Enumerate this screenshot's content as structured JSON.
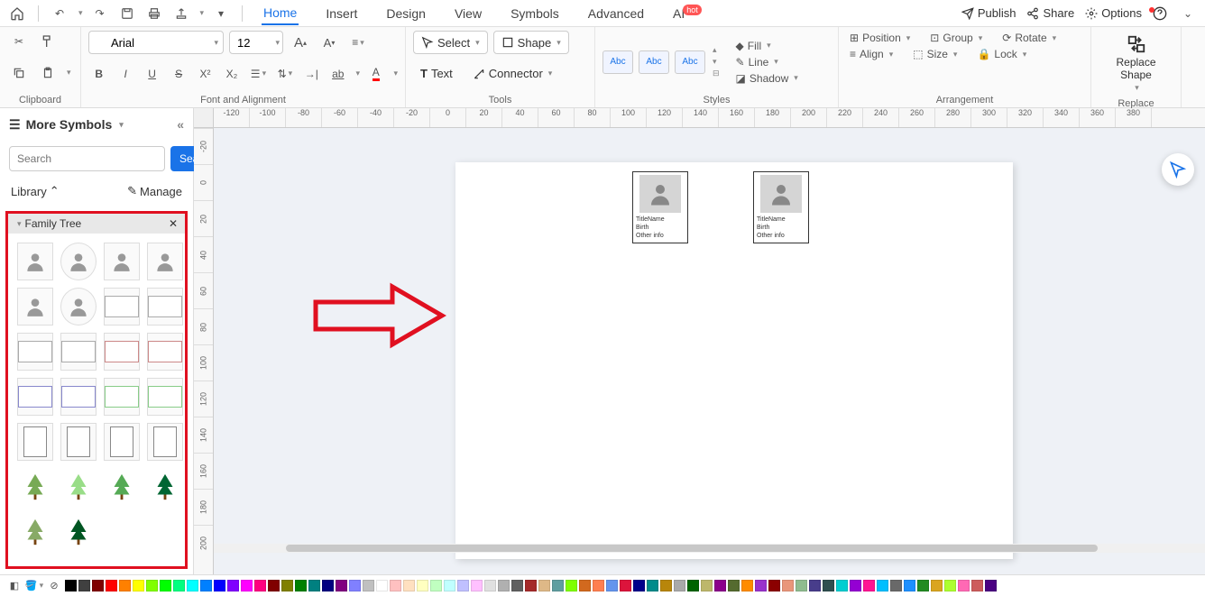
{
  "titlebar": {
    "publish": "Publish",
    "share": "Share",
    "options": "Options"
  },
  "menu": {
    "home": "Home",
    "insert": "Insert",
    "design": "Design",
    "view": "View",
    "symbols": "Symbols",
    "advanced": "Advanced",
    "ai": "AI",
    "ai_badge": "hot"
  },
  "ribbon": {
    "clipboard_label": "Clipboard",
    "font_label": "Font and Alignment",
    "tools_label": "Tools",
    "styles_label": "Styles",
    "arrangement_label": "Arrangement",
    "replace_label": "Replace",
    "font_name": "Arial",
    "font_size": "12",
    "select": "Select",
    "shape": "Shape",
    "text": "Text",
    "connector": "Connector",
    "abc": "Abc",
    "fill": "Fill",
    "line": "Line",
    "shadow": "Shadow",
    "position": "Position",
    "align": "Align",
    "group": "Group",
    "size": "Size",
    "rotate": "Rotate",
    "lock": "Lock",
    "replace_shape": "Replace\nShape"
  },
  "sidebar": {
    "title": "More Symbols",
    "search_placeholder": "Search",
    "search_btn": "Search",
    "library": "Library",
    "manage": "Manage",
    "panel_title": "Family Tree"
  },
  "canvas": {
    "card1": {
      "title": "TitleName",
      "birth": "Birth",
      "other": "Other info"
    },
    "card2": {
      "title": "TitleName",
      "birth": "Birth",
      "other": "Other info"
    }
  },
  "ruler_h": [
    "-120",
    "-100",
    "-80",
    "-60",
    "-40",
    "-20",
    "0",
    "20",
    "40",
    "60",
    "80",
    "100",
    "120",
    "140",
    "160",
    "180",
    "200",
    "220",
    "240",
    "260",
    "280",
    "300",
    "320",
    "340",
    "360",
    "380"
  ],
  "ruler_v": [
    "-20",
    "0",
    "20",
    "40",
    "60",
    "80",
    "100",
    "120",
    "140",
    "160",
    "180",
    "200"
  ],
  "colors": [
    "#000000",
    "#404040",
    "#7f0000",
    "#ff0000",
    "#ff8000",
    "#ffff00",
    "#80ff00",
    "#00ff00",
    "#00ff80",
    "#00ffff",
    "#0080ff",
    "#0000ff",
    "#8000ff",
    "#ff00ff",
    "#ff0080",
    "#800000",
    "#808000",
    "#008000",
    "#008080",
    "#000080",
    "#800080",
    "#8080ff",
    "#c0c0c0",
    "#ffffff",
    "#ffc0c0",
    "#ffe0c0",
    "#ffffc0",
    "#c0ffc0",
    "#c0ffff",
    "#c0c0ff",
    "#ffc0ff",
    "#e0e0e0",
    "#b0b0b0",
    "#606060",
    "#a52a2a",
    "#deb887",
    "#5f9ea0",
    "#7fff00",
    "#d2691e",
    "#ff7f50",
    "#6495ed",
    "#dc143c",
    "#00008b",
    "#008b8b",
    "#b8860b",
    "#a9a9a9",
    "#006400",
    "#bdb76b",
    "#8b008b",
    "#556b2f",
    "#ff8c00",
    "#9932cc",
    "#8b0000",
    "#e9967a",
    "#8fbc8f",
    "#483d8b",
    "#2f4f4f",
    "#00ced1",
    "#9400d3",
    "#ff1493",
    "#00bfff",
    "#696969",
    "#1e90ff",
    "#228b22",
    "#daa520",
    "#adff2f",
    "#ff69b4",
    "#cd5c5c",
    "#4b0082"
  ]
}
